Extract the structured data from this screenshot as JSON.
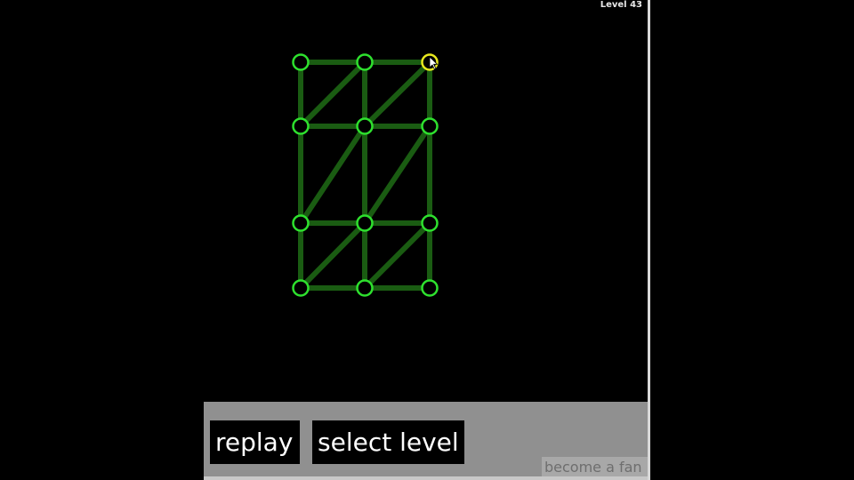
{
  "hud": {
    "level_label": "Level 43"
  },
  "buttons": {
    "replay": "replay",
    "select_level": "select level",
    "become_fan": "become a fan"
  },
  "colors": {
    "background": "#000000",
    "edge": "#1a5c12",
    "node": "#2ee02e",
    "active_node": "#e8e81e",
    "panel": "#909090"
  },
  "graph": {
    "nodes": [
      {
        "id": "a1",
        "col": 0,
        "row": 0
      },
      {
        "id": "b1",
        "col": 1,
        "row": 0
      },
      {
        "id": "c1",
        "col": 2,
        "row": 0,
        "active": true
      },
      {
        "id": "a2",
        "col": 0,
        "row": 1
      },
      {
        "id": "b2",
        "col": 1,
        "row": 1
      },
      {
        "id": "c2",
        "col": 2,
        "row": 1
      },
      {
        "id": "a3",
        "col": 0,
        "row": 2
      },
      {
        "id": "b3",
        "col": 1,
        "row": 2
      },
      {
        "id": "c3",
        "col": 2,
        "row": 2
      },
      {
        "id": "a4",
        "col": 0,
        "row": 3
      },
      {
        "id": "b4",
        "col": 1,
        "row": 3
      },
      {
        "id": "c4",
        "col": 2,
        "row": 3
      }
    ],
    "edges": [
      [
        "a1",
        "b1"
      ],
      [
        "b1",
        "c1"
      ],
      [
        "a2",
        "b2"
      ],
      [
        "b2",
        "c2"
      ],
      [
        "a3",
        "b3"
      ],
      [
        "b3",
        "c3"
      ],
      [
        "a4",
        "b4"
      ],
      [
        "b4",
        "c4"
      ],
      [
        "a1",
        "a2"
      ],
      [
        "a2",
        "a3"
      ],
      [
        "a3",
        "a4"
      ],
      [
        "b1",
        "b2"
      ],
      [
        "b2",
        "b3"
      ],
      [
        "b3",
        "b4"
      ],
      [
        "c1",
        "c2"
      ],
      [
        "c2",
        "c3"
      ],
      [
        "c3",
        "c4"
      ],
      [
        "a2",
        "b1"
      ],
      [
        "b2",
        "c1"
      ],
      [
        "a3",
        "b2"
      ],
      [
        "b3",
        "c2"
      ],
      [
        "a4",
        "b3"
      ],
      [
        "b4",
        "c3"
      ]
    ]
  }
}
